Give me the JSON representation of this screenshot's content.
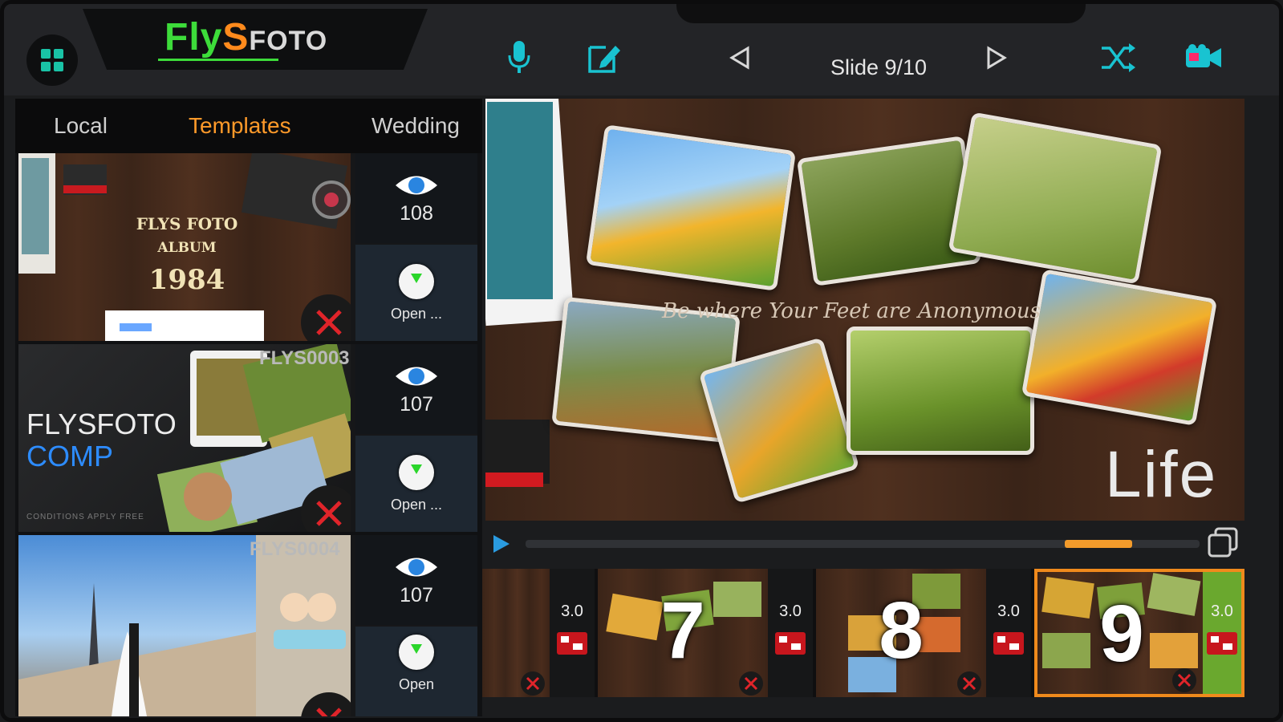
{
  "app": {
    "logo_part1": "Fly",
    "logo_part2": "S",
    "logo_part3": "FOTO"
  },
  "toolbar": {
    "slide_label": "Slide 9/10",
    "icons": [
      "grid-icon",
      "microphone-icon",
      "edit-icon",
      "prev-arrow-icon",
      "next-arrow-icon",
      "shuffle-icon",
      "video-camera-icon"
    ]
  },
  "tabs": [
    {
      "label": "Local",
      "active": false
    },
    {
      "label": "Templates",
      "active": true
    },
    {
      "label": "Wedding",
      "active": false
    }
  ],
  "templates": [
    {
      "title_line1": "FLYS FOTO",
      "title_line2": "ALBUM",
      "title_line3": "1984",
      "views": "108",
      "open_label": "Open ..."
    },
    {
      "title_line1": "FLYSFOTO",
      "title_line2": "COMP",
      "code": "FLYS0003",
      "fine_print": "CONDITIONS APPLY FREE",
      "views": "107",
      "open_label": "Open ..."
    },
    {
      "code": "FLYS0004",
      "views": "107",
      "open_label": "Open"
    }
  ],
  "preview": {
    "caption": "Be where Your Feet are Anonymous",
    "life_text": "Life"
  },
  "playback": {
    "progress_start": 0.8,
    "progress_end": 0.9
  },
  "timeline": [
    {
      "number": "",
      "duration": "3.0"
    },
    {
      "number": "7",
      "duration": "3.0"
    },
    {
      "number": "8",
      "duration": "3.0"
    },
    {
      "number": "9",
      "duration": "3.0",
      "selected": true
    }
  ],
  "colors": {
    "accent_orange": "#ff9a2a",
    "accent_green": "#3ddc3a",
    "teal_icon": "#19c3d1",
    "selected_border": "#f08a1c",
    "duration_selected": "#6aa82e"
  }
}
